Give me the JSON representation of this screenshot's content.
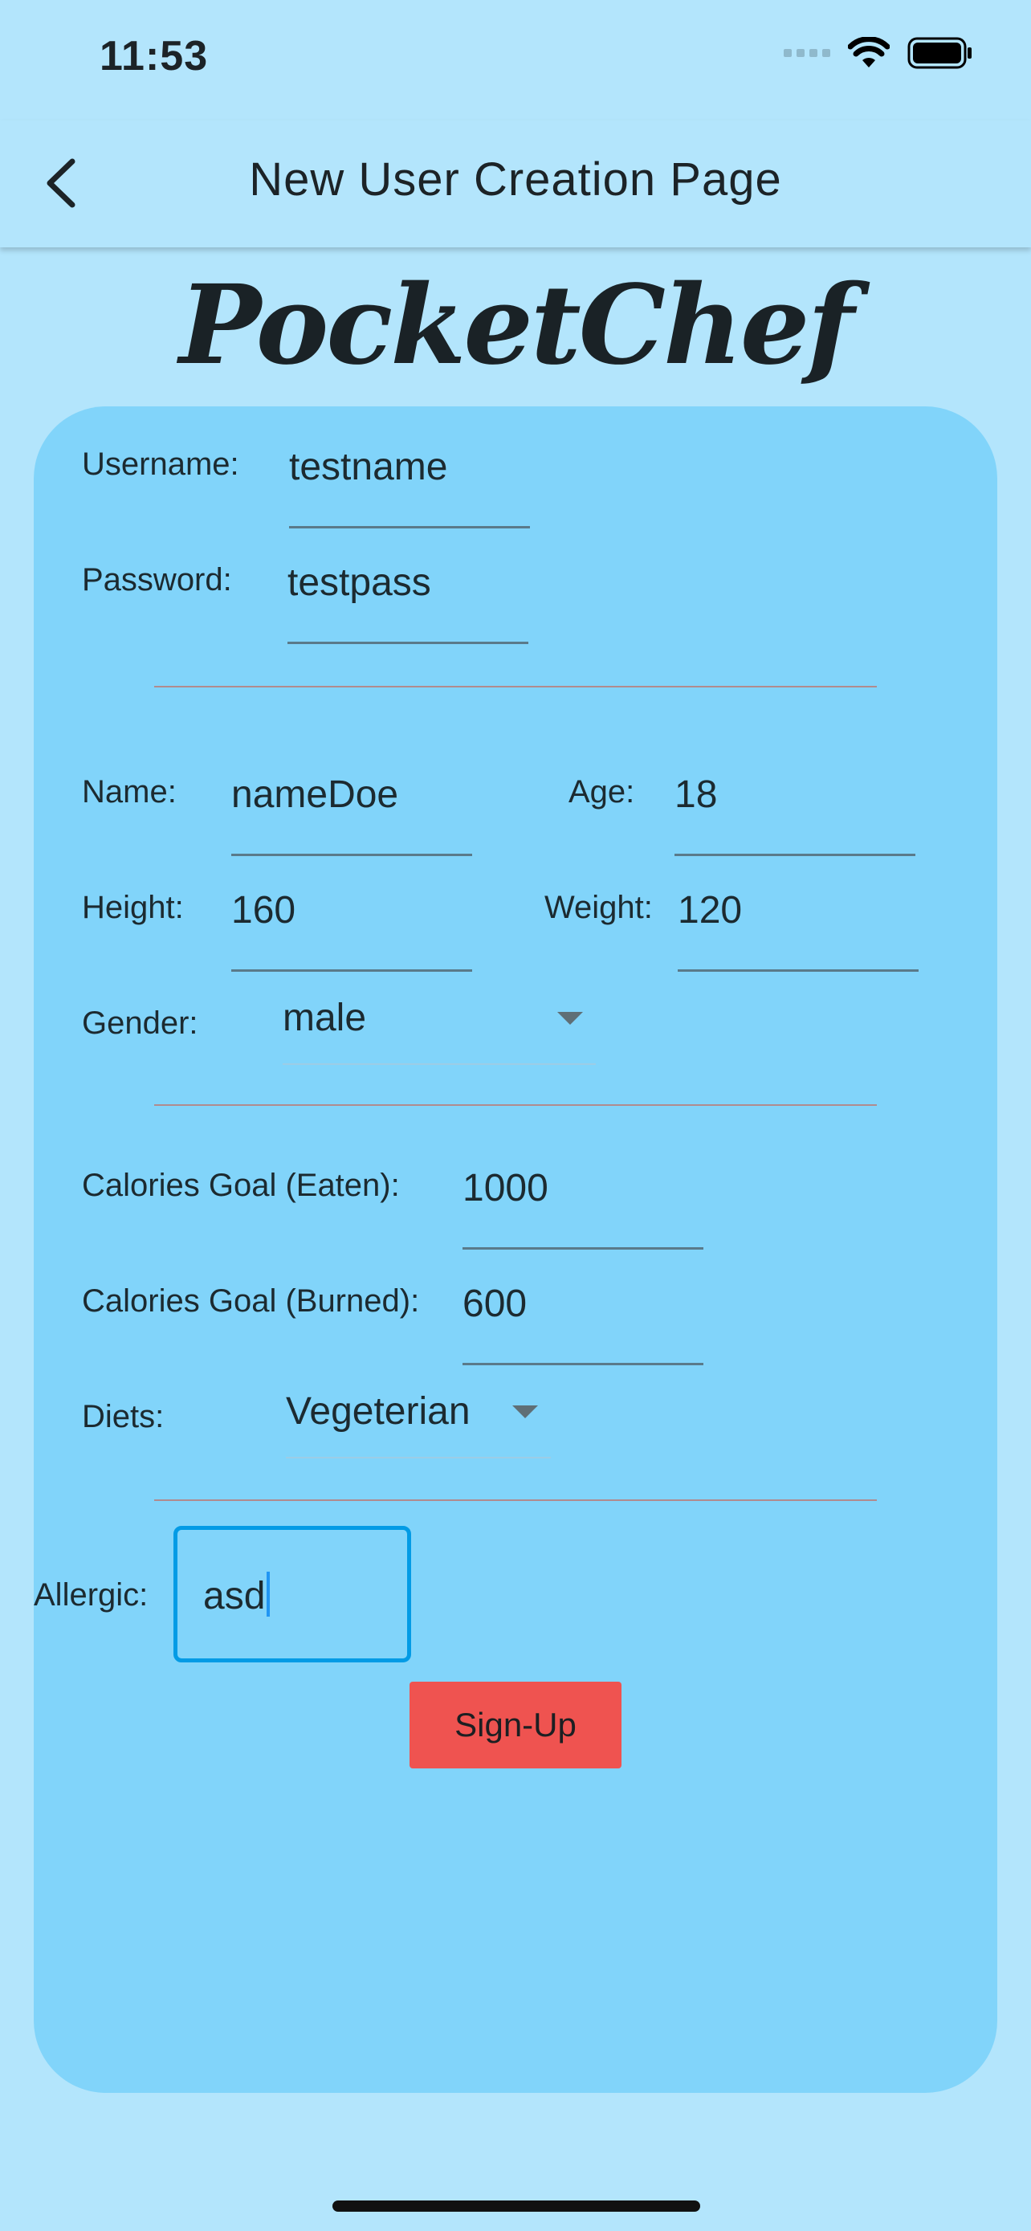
{
  "status_bar": {
    "time": "11:53"
  },
  "app_bar": {
    "title": "New User Creation Page"
  },
  "brand": {
    "name": "PocketChef"
  },
  "account": {
    "username_label": "Username:",
    "username_value": "testname",
    "password_label": "Password:",
    "password_value": "testpass"
  },
  "profile": {
    "name_label": "Name:",
    "name_value": "nameDoe",
    "age_label": "Age:",
    "age_value": "18",
    "height_label": "Height:",
    "height_value": "160",
    "weight_label": "Weight:",
    "weight_value": "120",
    "gender_label": "Gender:",
    "gender_value": "male"
  },
  "goals": {
    "eaten_label": "Calories Goal (Eaten):",
    "eaten_value": "1000",
    "burned_label": "Calories Goal (Burned):",
    "burned_value": "600",
    "diets_label": "Diets:",
    "diets_value": "Vegeterian"
  },
  "allergic": {
    "label": "Allergic:",
    "value": "asd"
  },
  "actions": {
    "signup_label": "Sign-Up"
  },
  "icons": [
    "back-arrow-icon",
    "cellular-signal-icon",
    "wifi-icon",
    "battery-icon",
    "dropdown-arrow-icon"
  ],
  "colors": {
    "background": "#b3e5fc",
    "card": "#81d4fa",
    "button": "#ef5350",
    "focus_border": "#039be5"
  }
}
